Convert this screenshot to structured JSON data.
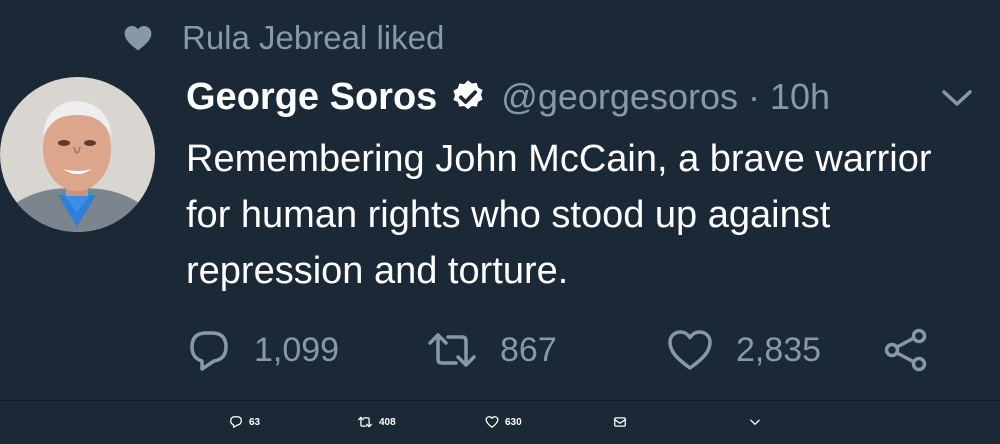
{
  "context": {
    "liked_by": "Rula Jebreal liked",
    "icon": "heart-icon"
  },
  "tweet": {
    "display_name": "George Soros",
    "verified_icon": "verified-badge-icon",
    "handle": "@georgesoros",
    "separator": "·",
    "time": "10h",
    "text": "Remembering John McCain, a brave warrior for human rights who stood up against repression and torture."
  },
  "actions": {
    "reply_count": "1,099",
    "retweet_count": "867",
    "like_count": "2,835",
    "icons": [
      "reply-icon",
      "retweet-icon",
      "like-icon",
      "share-icon"
    ]
  },
  "bottom_bar": {
    "reply_count": "63",
    "retweet_count": "408",
    "like_count": "630",
    "icons": [
      "reply-icon",
      "retweet-icon",
      "like-icon",
      "mail-icon",
      "chevron-down-icon"
    ]
  },
  "colors": {
    "background": "#1b2836",
    "secondary_text": "#8899a6",
    "primary_text": "#ffffff"
  }
}
